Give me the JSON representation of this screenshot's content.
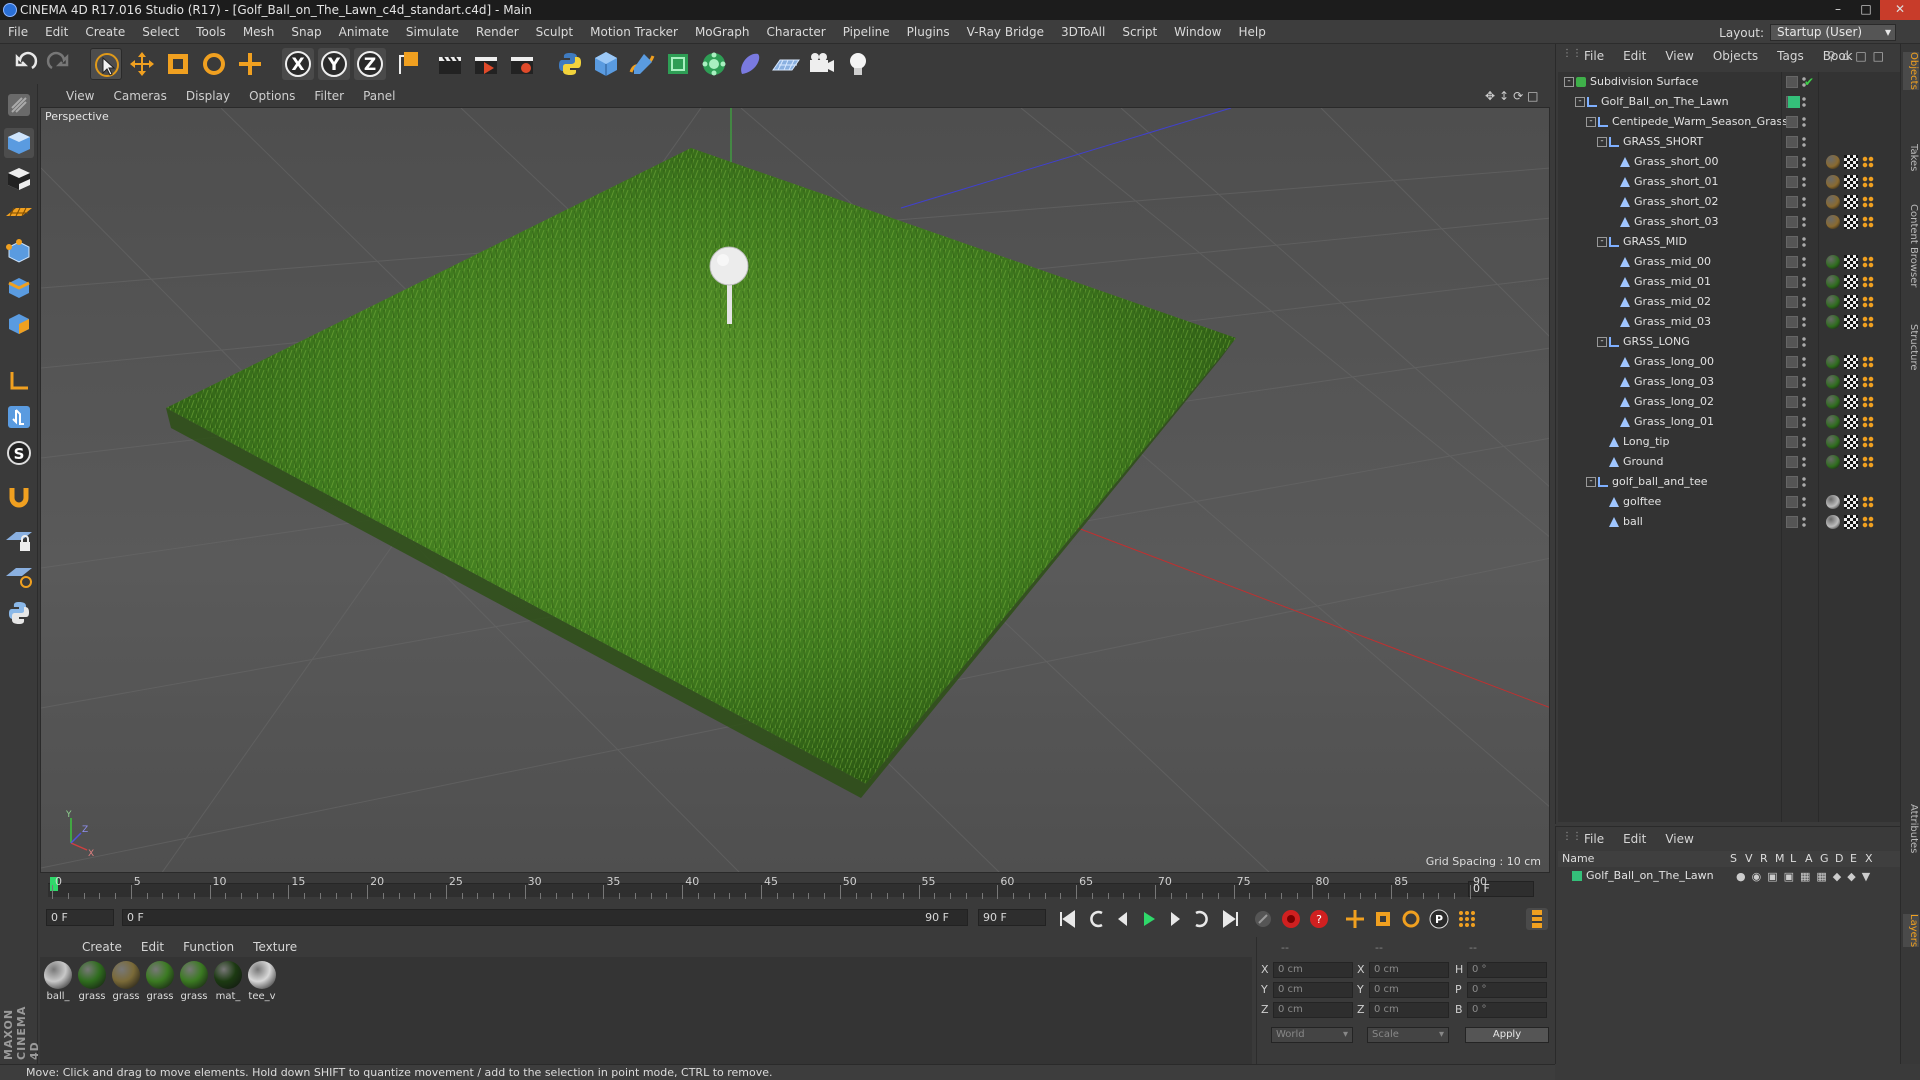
{
  "window": {
    "title": "CINEMA 4D R17.016 Studio (R17) - [Golf_Ball_on_The_Lawn_c4d_standart.c4d] - Main"
  },
  "menu": [
    "File",
    "Edit",
    "Create",
    "Select",
    "Tools",
    "Mesh",
    "Snap",
    "Animate",
    "Simulate",
    "Render",
    "Sculpt",
    "Motion Tracker",
    "MoGraph",
    "Character",
    "Pipeline",
    "Plugins",
    "V-Ray Bridge",
    "3DToAll",
    "Script",
    "Window",
    "Help"
  ],
  "layout": {
    "label": "Layout:",
    "value": "Startup (User)"
  },
  "viewport": {
    "menu": [
      "View",
      "Cameras",
      "Display",
      "Options",
      "Filter",
      "Panel"
    ],
    "label": "Perspective",
    "grid_spacing": "Grid Spacing : 10 cm"
  },
  "timeline": {
    "ticks": [
      "0",
      "5",
      "10",
      "15",
      "20",
      "25",
      "30",
      "35",
      "40",
      "45",
      "50",
      "55",
      "60",
      "65",
      "70",
      "75",
      "80",
      "85",
      "90"
    ],
    "current_frame": "0 F",
    "start_field": "0 F",
    "range_start": "0 F",
    "range_end": "90 F",
    "end_field": "90 F"
  },
  "materials": {
    "menu": [
      "Create",
      "Edit",
      "Function",
      "Texture"
    ],
    "items": [
      {
        "label": "ball_",
        "color": "#c9c9c9"
      },
      {
        "label": "grass",
        "color": "#2f6d1e"
      },
      {
        "label": "grass",
        "color": "#7a6a38"
      },
      {
        "label": "grass",
        "color": "#3b7a22"
      },
      {
        "label": "grass",
        "color": "#3b7a22"
      },
      {
        "label": "mat_",
        "color": "#1c3a12"
      },
      {
        "label": "tee_v",
        "color": "#d8d8d8"
      }
    ]
  },
  "coords": {
    "header": [
      "--",
      "--",
      "--"
    ],
    "pos_labels": [
      "X",
      "Y",
      "Z"
    ],
    "pos_values": [
      "0 cm",
      "0 cm",
      "0 cm"
    ],
    "size_labels": [
      "X",
      "Y",
      "Z"
    ],
    "size_values": [
      "0 cm",
      "0 cm",
      "0 cm"
    ],
    "rot_labels": [
      "H",
      "P",
      "B"
    ],
    "rot_values": [
      "0 °",
      "0 °",
      "0 °"
    ],
    "mode1": "World",
    "mode2": "Scale",
    "apply": "Apply"
  },
  "status": "Move: Click and drag to move elements. Hold down SHIFT to quantize movement / add to the selection in point mode, CTRL to remove.",
  "objects": {
    "menu": [
      "File",
      "Edit",
      "View",
      "Objects",
      "Tags",
      "Book"
    ],
    "rows": [
      {
        "name": "Subdivision Surface",
        "indent": 0,
        "tag": "none",
        "icon": "#3fb04a"
      },
      {
        "name": "Golf_Ball_on_The_Lawn",
        "indent": 1,
        "tag": "layer",
        "icon": "#7fb0ff"
      },
      {
        "name": "Centipede_Warm_Season_Grass",
        "indent": 2,
        "tag": "none",
        "icon": "#7fb0ff"
      },
      {
        "name": "GRASS_SHORT",
        "indent": 3,
        "tag": "none",
        "icon": "#7fb0ff"
      },
      {
        "name": "Grass_short_00",
        "indent": 4,
        "tag": "brown",
        "icon": "#9fc6ff"
      },
      {
        "name": "Grass_short_01",
        "indent": 4,
        "tag": "brown",
        "icon": "#9fc6ff"
      },
      {
        "name": "Grass_short_02",
        "indent": 4,
        "tag": "brown",
        "icon": "#9fc6ff"
      },
      {
        "name": "Grass_short_03",
        "indent": 4,
        "tag": "brown",
        "icon": "#9fc6ff"
      },
      {
        "name": "GRASS_MID",
        "indent": 3,
        "tag": "none",
        "icon": "#7fb0ff"
      },
      {
        "name": "Grass_mid_00",
        "indent": 4,
        "tag": "green",
        "icon": "#9fc6ff"
      },
      {
        "name": "Grass_mid_01",
        "indent": 4,
        "tag": "green",
        "icon": "#9fc6ff"
      },
      {
        "name": "Grass_mid_02",
        "indent": 4,
        "tag": "green",
        "icon": "#9fc6ff"
      },
      {
        "name": "Grass_mid_03",
        "indent": 4,
        "tag": "green",
        "icon": "#9fc6ff"
      },
      {
        "name": "GRSS_LONG",
        "indent": 3,
        "tag": "none",
        "icon": "#7fb0ff"
      },
      {
        "name": "Grass_long_00",
        "indent": 4,
        "tag": "green",
        "icon": "#9fc6ff"
      },
      {
        "name": "Grass_long_03",
        "indent": 4,
        "tag": "green",
        "icon": "#9fc6ff"
      },
      {
        "name": "Grass_long_02",
        "indent": 4,
        "tag": "green",
        "icon": "#9fc6ff"
      },
      {
        "name": "Grass_long_01",
        "indent": 4,
        "tag": "green",
        "icon": "#9fc6ff"
      },
      {
        "name": "Long_tip",
        "indent": 3,
        "tag": "green",
        "icon": "#9fc6ff"
      },
      {
        "name": "Ground",
        "indent": 3,
        "tag": "green",
        "icon": "#9fc6ff"
      },
      {
        "name": "golf_ball_and_tee",
        "indent": 2,
        "tag": "none",
        "icon": "#7fb0ff"
      },
      {
        "name": "golftee",
        "indent": 3,
        "tag": "white",
        "icon": "#9fc6ff"
      },
      {
        "name": "ball",
        "indent": 3,
        "tag": "white",
        "icon": "#9fc6ff"
      }
    ]
  },
  "layers": {
    "menu": [
      "File",
      "Edit",
      "View"
    ],
    "columns": [
      "Name",
      "S",
      "V",
      "R",
      "M",
      "L",
      "A",
      "G",
      "D",
      "E",
      "X"
    ],
    "row_name": "Golf_Ball_on_The_Lawn"
  },
  "sidetabs": [
    "Objects",
    "Takes",
    "Content Browser",
    "Structure",
    "Attributes",
    "Layers"
  ],
  "colors": {
    "accent": "#f0a020",
    "layer_green": "#34c07a",
    "grass": "#3f7a22"
  }
}
